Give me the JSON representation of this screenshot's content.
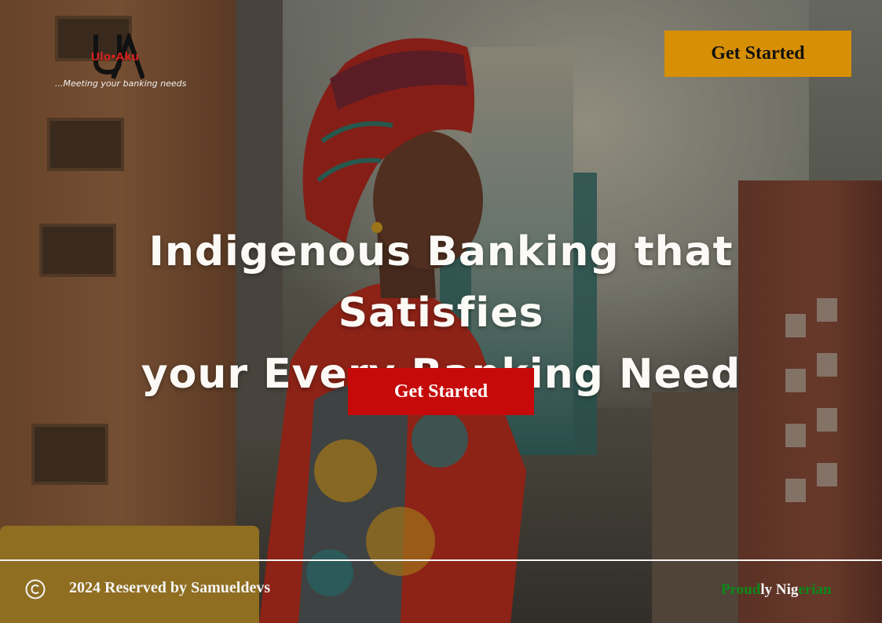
{
  "brand": {
    "logo_text": "Ulo•Aku",
    "tagline": "...Meeting your banking needs"
  },
  "header": {
    "cta_label": "Get Started"
  },
  "hero": {
    "title_line1": "Indigenous Banking that Satisfies",
    "title_line2": "your Every Banking Need",
    "cta_label": "Get Started"
  },
  "footer": {
    "copyright_icon": "copyright-icon",
    "copyright_text": "2024 Reserved by Samueldevs",
    "slogan_parts": [
      "Proud",
      "ly Nig",
      "erian"
    ]
  },
  "colors": {
    "header_button": "#d78f05",
    "hero_button": "#c60a0a",
    "logo_red": "#e2201b",
    "nigeria_green": "#0a8a1a"
  }
}
